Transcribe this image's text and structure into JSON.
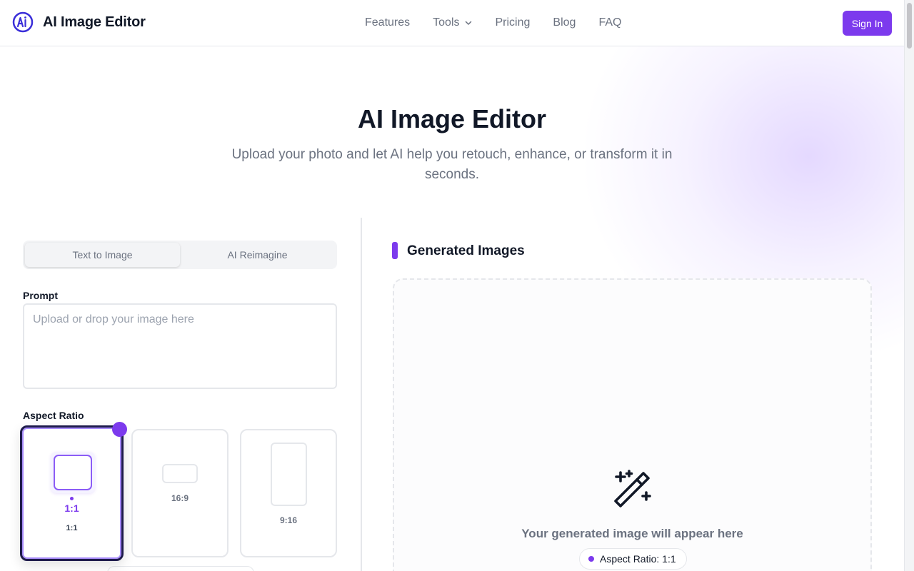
{
  "header": {
    "brand": "AI Image Editor",
    "nav": [
      {
        "label": "Features"
      },
      {
        "label": "Tools"
      },
      {
        "label": "Pricing"
      },
      {
        "label": "Blog"
      },
      {
        "label": "FAQ"
      }
    ],
    "sign_in_label": "Sign In"
  },
  "hero": {
    "title": "AI Image Editor",
    "subtitle": "Upload your photo and let AI help you retouch, enhance, or transform it in seconds."
  },
  "tabs": [
    {
      "label": "Text to Image",
      "active": true
    },
    {
      "label": "AI Reimagine",
      "active": false
    }
  ],
  "prompt": {
    "label": "Prompt",
    "placeholder": "Upload or drop your image here"
  },
  "aspect_ratio": {
    "label": "Aspect Ratio",
    "selected": "1:1",
    "selected_sub": "1:1",
    "options": [
      {
        "label": "1:1"
      },
      {
        "label": "16:9"
      },
      {
        "label": "9:16"
      }
    ]
  },
  "output": {
    "title": "Generated Images",
    "placeholder_text": "Your generated image will appear here",
    "aspect_pill": "Aspect Ratio: 1:1"
  },
  "icons": {
    "logo": "ai-logo-icon",
    "tools_dropdown": "chevron-down-icon",
    "output": "magic-wand-icon"
  },
  "colors": {
    "accent": "#7c3aed",
    "text": "#111827",
    "muted": "#6b7280",
    "border": "#e5e7eb"
  }
}
